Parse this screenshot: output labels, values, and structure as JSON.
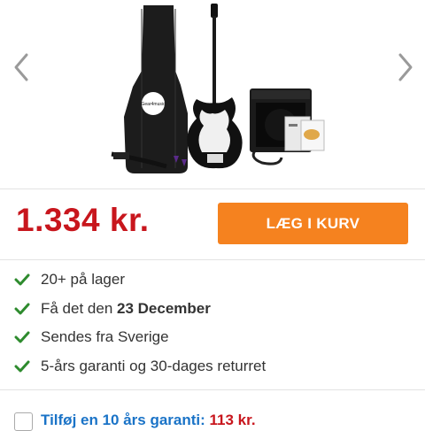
{
  "product": {
    "image_alt": "Bass guitar pack with gig bag, amplifier, cable, strap and picks",
    "gigbag_logo": "Gear4music"
  },
  "price": "1.334 kr.",
  "add_to_cart_label": "LÆG I KURV",
  "features": [
    {
      "text": "20+ på lager"
    },
    {
      "prefix": "Få det den ",
      "bold": "23 December"
    },
    {
      "text": "Sendes fra Sverige"
    },
    {
      "text": "5-års garanti og 30-dages returret"
    }
  ],
  "warranty": {
    "label": "Tilføj en 10 års garanti:",
    "price": "113 kr."
  },
  "colors": {
    "price": "#c8161d",
    "button": "#f5821f",
    "check": "#2e8b2e",
    "link": "#1a73c7"
  }
}
